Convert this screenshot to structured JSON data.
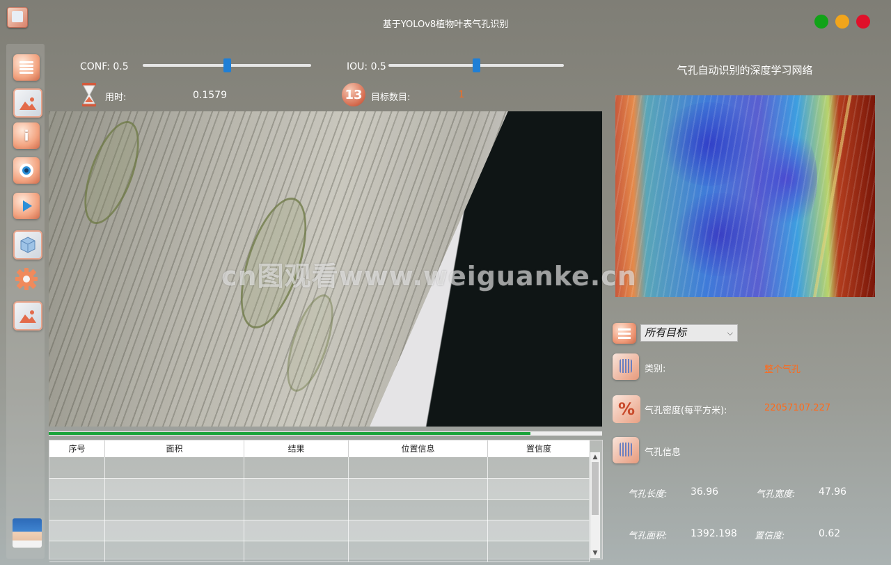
{
  "window": {
    "title": "基于YOLOv8植物叶表气孔识别"
  },
  "controls": {
    "conf_label": "CONF: 0.5",
    "conf_value": 0.5,
    "iou_label": "IOU: 0.5",
    "iou_value": 0.5,
    "time_label": "用时:",
    "time_value": "0.1579",
    "target_count_label": "目标数目:",
    "target_count_value": "1"
  },
  "progress": {
    "fraction": 0.87,
    "color": "#1aa33a"
  },
  "table": {
    "columns": [
      "序号",
      "面积",
      "结果",
      "位置信息",
      "置信度"
    ],
    "rows": 5
  },
  "right_panel": {
    "title": "气孔自动识别的深度学习网络",
    "target_select": "所有目标",
    "class_label": "类别:",
    "class_value": "整个气孔",
    "density_label": "气孔密度(每平方米):",
    "density_value": "22057107.227",
    "info_label": "气孔信息",
    "length_label": "气孔长度:",
    "length_value": "36.96",
    "width_label": "气孔宽度:",
    "width_value": "47.96",
    "area_label": "气孔面积:",
    "area_value": "1392.198",
    "conf_label": "置信度:",
    "conf_value": "0.62"
  },
  "watermark": "cn图观看www.weiguanke.cn",
  "colors": {
    "accent_blue": "#1f7fd6",
    "value_orange": "#ff6a1a",
    "btn_green": "#11a318",
    "btn_yellow": "#f2a51b",
    "btn_red": "#e0102a"
  },
  "icons": {
    "sidebar": [
      "menu-icon",
      "image-icon",
      "info-icon",
      "camera-icon",
      "play-icon",
      "cube-icon",
      "gear-icon",
      "image-icon"
    ]
  }
}
